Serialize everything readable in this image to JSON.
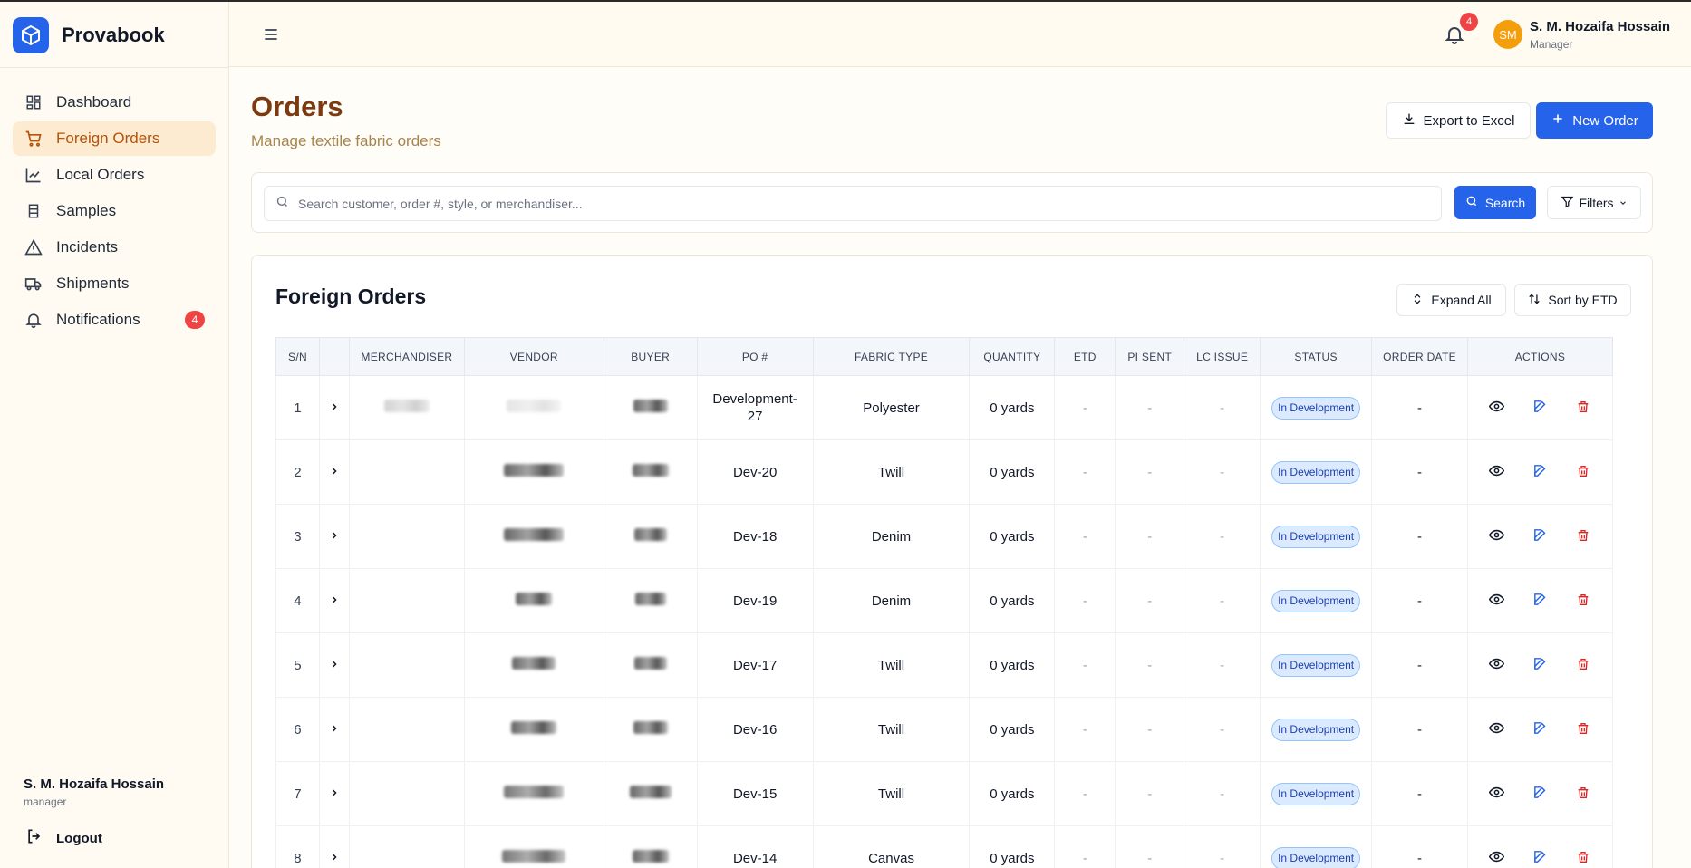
{
  "app": {
    "name": "Provabook"
  },
  "sidebar": {
    "items": [
      {
        "label": "Dashboard",
        "icon": "dashboard-icon"
      },
      {
        "label": "Foreign Orders",
        "icon": "cart-icon",
        "active": true
      },
      {
        "label": "Local Orders",
        "icon": "chart-icon"
      },
      {
        "label": "Samples",
        "icon": "flask-icon"
      },
      {
        "label": "Incidents",
        "icon": "warning-icon"
      },
      {
        "label": "Shipments",
        "icon": "truck-icon"
      },
      {
        "label": "Notifications",
        "icon": "bell-icon",
        "badge": "4"
      }
    ],
    "user": {
      "name": "S. M. Hozaifa Hossain",
      "role": "manager"
    },
    "logout_label": "Logout"
  },
  "header": {
    "notification_count": "4",
    "avatar_initials": "SM",
    "user_name": "S. M. Hozaifa Hossain",
    "user_role": "Manager"
  },
  "page": {
    "title": "Orders",
    "subtitle": "Manage textile fabric orders",
    "export_label": "Export to Excel",
    "new_order_label": "New Order"
  },
  "search": {
    "placeholder": "Search customer, order #, style, or merchandiser...",
    "search_label": "Search",
    "filters_label": "Filters"
  },
  "orders": {
    "title": "Foreign Orders",
    "expand_all_label": "Expand All",
    "sort_label": "Sort by ETD",
    "columns": [
      "S/N",
      "",
      "MERCHANDISER",
      "VENDOR",
      "BUYER",
      "PO #",
      "FABRIC TYPE",
      "QUANTITY",
      "ETD",
      "PI SENT",
      "LC ISSUE",
      "STATUS",
      "ORDER DATE",
      "ACTIONS"
    ],
    "rows": [
      {
        "sn": "1",
        "po": "Development-27",
        "fabric": "Polyester",
        "quantity": "0 yards",
        "etd": "-",
        "pi_sent": "-",
        "lc_issue": "-",
        "status": "In Development",
        "order_date": "-"
      },
      {
        "sn": "2",
        "po": "Dev-20",
        "fabric": "Twill",
        "quantity": "0 yards",
        "etd": "-",
        "pi_sent": "-",
        "lc_issue": "-",
        "status": "In Development",
        "order_date": "-"
      },
      {
        "sn": "3",
        "po": "Dev-18",
        "fabric": "Denim",
        "quantity": "0 yards",
        "etd": "-",
        "pi_sent": "-",
        "lc_issue": "-",
        "status": "In Development",
        "order_date": "-"
      },
      {
        "sn": "4",
        "po": "Dev-19",
        "fabric": "Denim",
        "quantity": "0 yards",
        "etd": "-",
        "pi_sent": "-",
        "lc_issue": "-",
        "status": "In Development",
        "order_date": "-"
      },
      {
        "sn": "5",
        "po": "Dev-17",
        "fabric": "Twill",
        "quantity": "0 yards",
        "etd": "-",
        "pi_sent": "-",
        "lc_issue": "-",
        "status": "In Development",
        "order_date": "-"
      },
      {
        "sn": "6",
        "po": "Dev-16",
        "fabric": "Twill",
        "quantity": "0 yards",
        "etd": "-",
        "pi_sent": "-",
        "lc_issue": "-",
        "status": "In Development",
        "order_date": "-"
      },
      {
        "sn": "7",
        "po": "Dev-15",
        "fabric": "Twill",
        "quantity": "0 yards",
        "etd": "-",
        "pi_sent": "-",
        "lc_issue": "-",
        "status": "In Development",
        "order_date": "-"
      },
      {
        "sn": "8",
        "po": "Dev-14",
        "fabric": "Canvas",
        "quantity": "0 yards",
        "etd": "-",
        "pi_sent": "-",
        "lc_issue": "-",
        "status": "In Development",
        "order_date": "-"
      }
    ]
  },
  "colors": {
    "accent": "#2563eb",
    "title": "#7c3a10",
    "active_nav_bg": "#fdebd1",
    "badge": "#ef4444",
    "delete": "#dc2626"
  }
}
